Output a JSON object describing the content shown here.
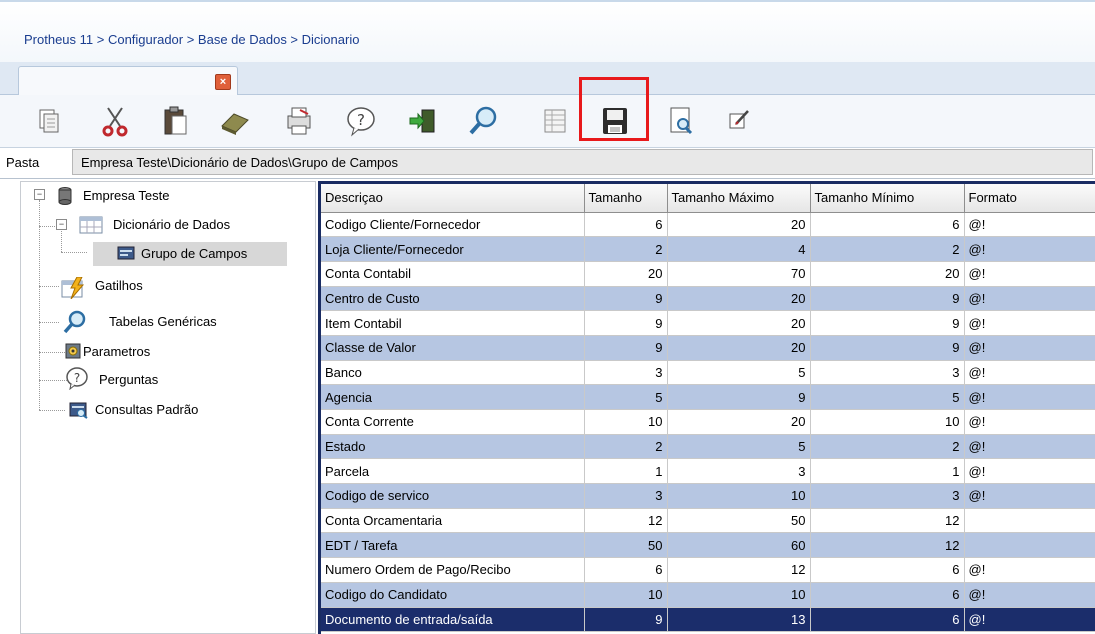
{
  "breadcrumb": "Protheus 11 > Configurador > Base de Dados > Dicionario",
  "tab": {
    "close_glyph": "×"
  },
  "toolbar": {
    "buttons": [
      {
        "name": "copy-icon"
      },
      {
        "name": "cut-icon"
      },
      {
        "name": "paste-icon"
      },
      {
        "name": "eraser-icon"
      },
      {
        "name": "print-icon"
      },
      {
        "name": "help-icon"
      },
      {
        "name": "exit-icon"
      },
      {
        "name": "search-icon"
      },
      {
        "name": "grid-icon"
      },
      {
        "name": "save-icon"
      },
      {
        "name": "preview-icon"
      },
      {
        "name": "edit-icon"
      }
    ]
  },
  "path": {
    "label": "Pasta",
    "value": "Empresa Teste\\Dicionário de Dados\\Grupo de Campos"
  },
  "tree": {
    "root": "Empresa Teste",
    "dictionary": "Dicionário de Dados",
    "field_group": "Grupo de Campos",
    "triggers": "Gatilhos",
    "generic_tables": "Tabelas Genéricas",
    "parameters": "Parametros",
    "questions": "Perguntas",
    "standard_queries": "Consultas Padrão"
  },
  "grid": {
    "columns": [
      "Descriçao",
      "Tamanho",
      "Tamanho Máximo",
      "Tamanho Mínimo",
      "Formato"
    ],
    "selected_row": 16,
    "rows": [
      [
        "Codigo Cliente/Fornecedor",
        "6",
        "20",
        "6",
        "@!"
      ],
      [
        "Loja Cliente/Fornecedor",
        "2",
        "4",
        "2",
        "@!"
      ],
      [
        "Conta Contabil",
        "20",
        "70",
        "20",
        "@!"
      ],
      [
        "Centro de Custo",
        "9",
        "20",
        "9",
        "@!"
      ],
      [
        "Item Contabil",
        "9",
        "20",
        "9",
        "@!"
      ],
      [
        "Classe de Valor",
        "9",
        "20",
        "9",
        "@!"
      ],
      [
        "Banco",
        "3",
        "5",
        "3",
        "@!"
      ],
      [
        "Agencia",
        "5",
        "9",
        "5",
        "@!"
      ],
      [
        "Conta Corrente",
        "10",
        "20",
        "10",
        "@!"
      ],
      [
        "Estado",
        "2",
        "5",
        "2",
        "@!"
      ],
      [
        "Parcela",
        "1",
        "3",
        "1",
        "@!"
      ],
      [
        "Codigo de servico",
        "3",
        "10",
        "3",
        "@!"
      ],
      [
        "Conta Orcamentaria",
        "12",
        "50",
        "12",
        ""
      ],
      [
        "EDT / Tarefa",
        "50",
        "60",
        "12",
        ""
      ],
      [
        "Numero Ordem de Pago/Recibo",
        "6",
        "12",
        "6",
        "@!"
      ],
      [
        "Codigo do Candidato",
        "10",
        "10",
        "6",
        "@!"
      ],
      [
        "Documento de entrada/saída",
        "9",
        "13",
        "6",
        "@!"
      ]
    ]
  },
  "colors": {
    "highlight": "#e8191b",
    "alt_row": "#b6c6e2",
    "selected_row": "#1b2d6b"
  }
}
